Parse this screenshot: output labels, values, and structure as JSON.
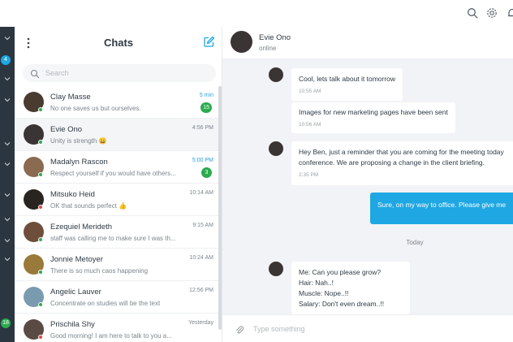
{
  "topbar": {
    "icons": [
      "search-icon",
      "gear-icon",
      "bell-icon"
    ]
  },
  "rail": {
    "badges": [
      {
        "label": "4",
        "color": "#1ea7e3"
      },
      {
        "label": "18",
        "color": "#2bab4f"
      }
    ]
  },
  "list": {
    "title": "Chats",
    "search_placeholder": "Search",
    "chats": [
      {
        "name": "Clay Masse",
        "preview": "No one saves us but ourselves.",
        "time": "5 min",
        "unread": "15",
        "status_color": "#2bab4f",
        "avatar_color": "#4a3b30"
      },
      {
        "name": "Evie Ono",
        "preview": "Unity is strength 😀",
        "time": "4:56 PM",
        "unread": "",
        "status_color": "#2bab4f",
        "avatar_color": "#3a3434"
      },
      {
        "name": "Madalyn Rascon",
        "preview": "Respect yourself if you would have others...",
        "time": "5:00 PM",
        "unread": "3",
        "status_color": "#2bab4f",
        "avatar_color": "#8a6a50"
      },
      {
        "name": "Mitsuko Heid",
        "preview": "OK that sounds perfect 👍",
        "time": "10:14 AM",
        "unread": "",
        "status_color": "#e64545",
        "avatar_color": "#2a2420"
      },
      {
        "name": "Ezequiel Merideth",
        "preview": "staff was calling me to make sure I was th...",
        "time": "9:15 AM",
        "unread": "",
        "status_color": "#2bab4f",
        "avatar_color": "#6e4e3a"
      },
      {
        "name": "Jonnie Metoyer",
        "preview": "There is so much caos happening",
        "time": "10:24 AM",
        "unread": "",
        "status_color": "#2bab4f",
        "avatar_color": "#9a7a3a"
      },
      {
        "name": "Angelic Lauver",
        "preview": "Concentrate on studies will be the text",
        "time": "12:56 PM",
        "unread": "",
        "status_color": "#2bab4f",
        "avatar_color": "#7a9ab0"
      },
      {
        "name": "Prischila Shy",
        "preview": "Good morning! I am here to talk to you a...",
        "time": "Yesterday",
        "unread": "",
        "status_color": "#e64545",
        "avatar_color": "#5a4a44"
      }
    ]
  },
  "conversation": {
    "name": "Evie Ono",
    "status": "online",
    "messages": [
      {
        "lines": [
          "Cool, lets talk about it tomorrow"
        ],
        "time": "10:55 AM"
      },
      {
        "lines": [
          "Images for new marketing pages have been sent"
        ],
        "time": "10:56 AM"
      },
      {
        "lines": [
          "Hey Ben, just a reminder that you are coming for the meeting today",
          "conference. We are proposing a change in the client briefing."
        ],
        "time": "2:35 PM"
      },
      {
        "lines": [
          "Sure, on my way to office. Please give me"
        ],
        "time": ""
      },
      {
        "lines": [
          "Me: Can you please grow?",
          "Hair: Nah..!",
          "Muscle: Nope..!!",
          "Salary: Don't even dream..!!"
        ],
        "time": ""
      }
    ],
    "day_separator": "Today",
    "composer_placeholder": "Type something"
  },
  "colors": {
    "accent": "#1ea7e3",
    "online": "#2bab4f",
    "busy": "#e64545",
    "rail": "#2b3640"
  }
}
